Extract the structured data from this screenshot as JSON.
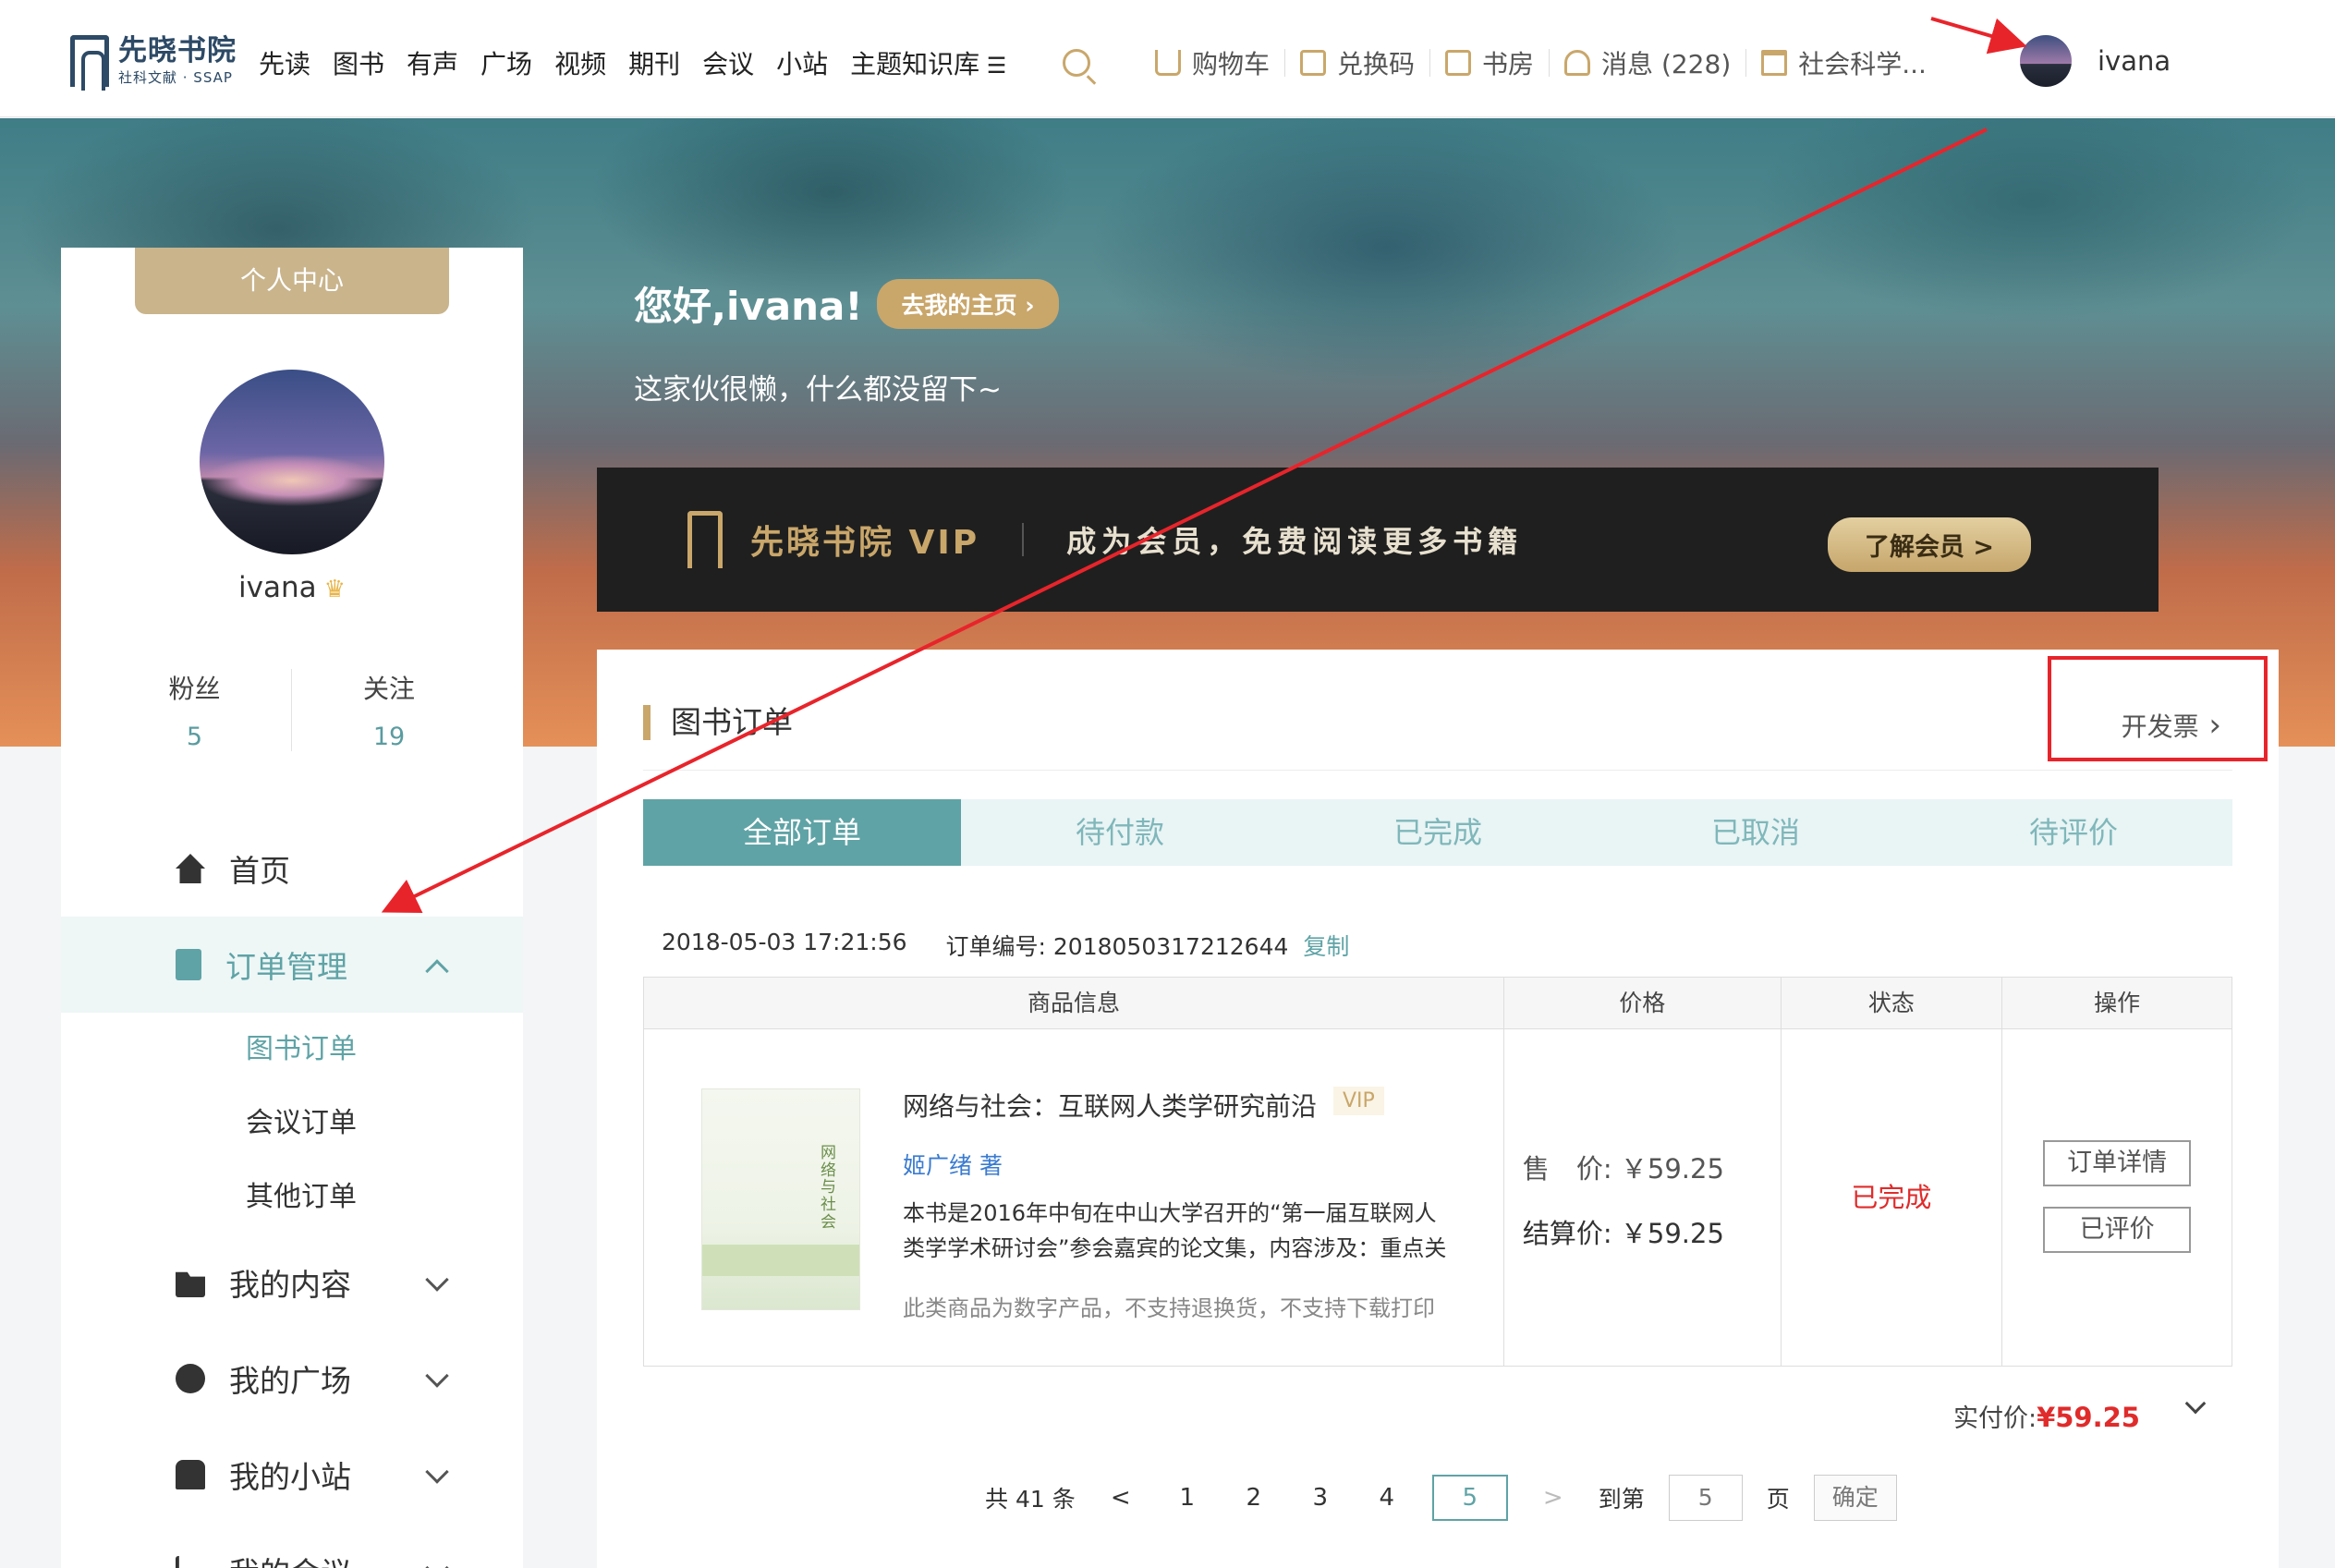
{
  "brand": {
    "name_cn": "先晓书院",
    "name_en": "社科文献 · SSAP"
  },
  "nav": {
    "links": [
      "先读",
      "图书",
      "有声",
      "广场",
      "视频",
      "期刊",
      "会议",
      "小站"
    ],
    "kb_label": "主题知识库",
    "cart": "购物车",
    "redeem": "兑换码",
    "shelf": "书房",
    "messages": "消息 (228)",
    "org": "社会科学..."
  },
  "user": {
    "name": "ivana"
  },
  "hero": {
    "greeting": "您好,ivana!",
    "home_button": "去我的主页",
    "motto": "这家伙很懒，什么都没留下~"
  },
  "vip": {
    "title": "先晓书院 VIP",
    "slogan": "成为会员，免费阅读更多书籍",
    "button": "了解会员 >"
  },
  "sidebar": {
    "header": "个人中心",
    "name": "ivana",
    "fans_label": "粉丝",
    "fans": "5",
    "follow_label": "关注",
    "follow": "19",
    "home": "首页",
    "orders": "订单管理",
    "sub": [
      "图书订单",
      "会议订单",
      "其他订单"
    ],
    "content": "我的内容",
    "square": "我的广场",
    "station": "我的小站",
    "meeting": "我的会议"
  },
  "main": {
    "title": "图书订单",
    "invoice": "开发票",
    "tabs": [
      "全部订单",
      "待付款",
      "已完成",
      "已取消",
      "待评价"
    ],
    "order_time": "2018-05-03 17:21:56",
    "order_no": "订单编号: 2018050317212644",
    "copy": "复制",
    "headers": [
      "商品信息",
      "价格",
      "状态",
      "操作"
    ],
    "product": {
      "title": "网络与社会：互联网人类学研究前沿",
      "tag": "VIP",
      "author": "姬广绪 著",
      "desc": "本书是2016年中旬在中山大学召开的“第一届互联网人类学学术研讨会”参会嘉宾的论文集，内容涉及：重点关",
      "note": "此类商品为数字产品，不支持退换货，不支持下载打印",
      "cover_text": "网络与社会"
    },
    "price_sale": "售　价: ￥59.25",
    "price_settle": "结算价: ￥59.25",
    "status": "已完成",
    "op_detail": "订单详情",
    "op_review": "已评价",
    "paid_label": "实付价:",
    "paid_value": "¥59.25"
  },
  "pager": {
    "total": "共 41 条",
    "prev": "<",
    "pages": [
      "1",
      "2",
      "3",
      "4",
      "5"
    ],
    "next": ">",
    "goto": "到第",
    "goto_value": "5",
    "unit": "页",
    "ok": "确定"
  },
  "colors": {
    "accent": "#5fa3a6",
    "gold": "#c9a66a",
    "annotation": "#e8242b"
  }
}
